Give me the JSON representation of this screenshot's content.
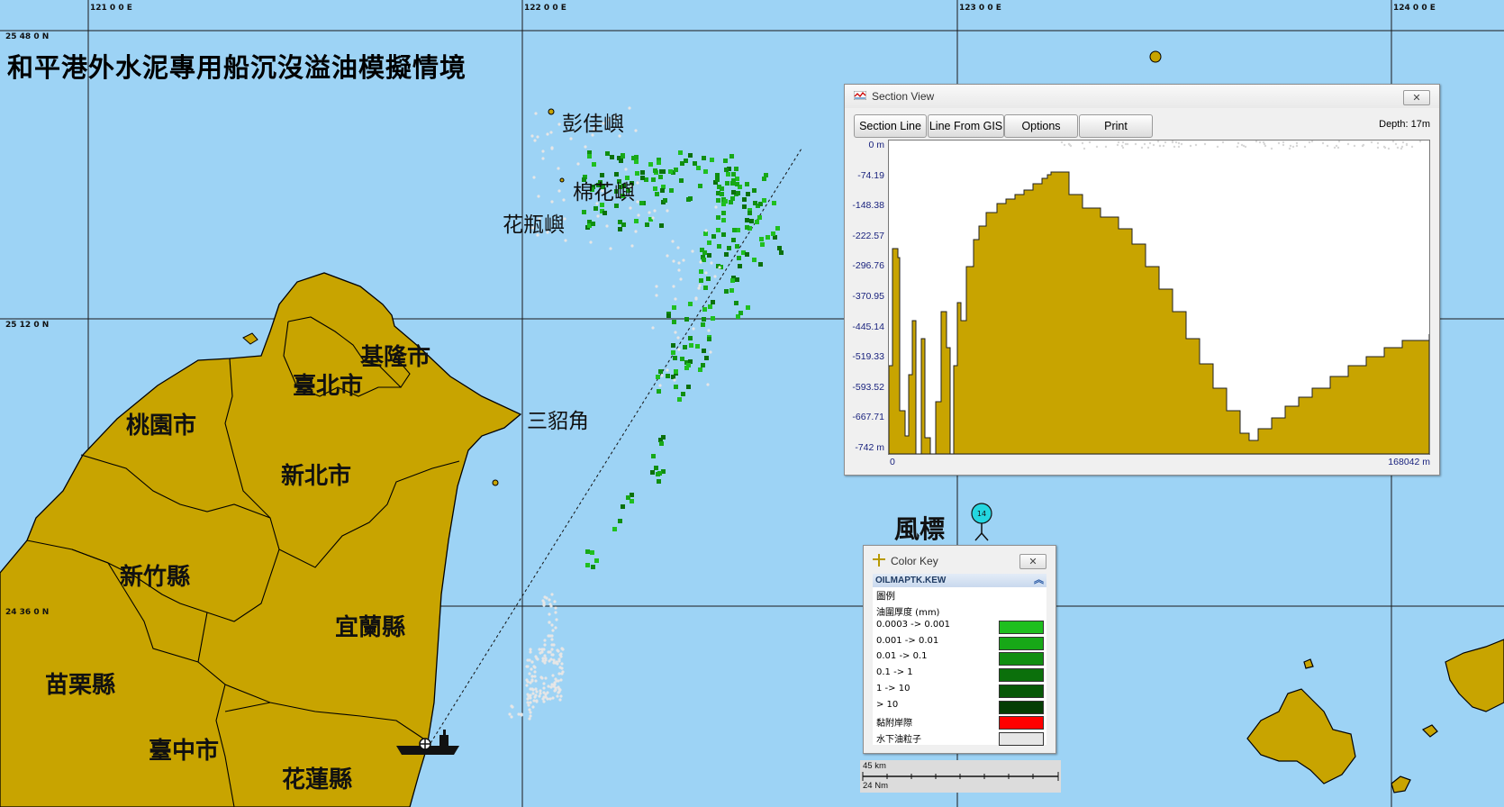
{
  "title": "和平港外水泥專用船沉沒溢油模擬情境",
  "grid": {
    "lon_labels": [
      "121 0 0 E",
      "122 0 0 E",
      "123 0 0 E",
      "124 0 0 E"
    ],
    "lat_labels": [
      "25 48 0 N",
      "25 12 0 N",
      "24 36 0 N"
    ]
  },
  "places": {
    "keelung": "基隆市",
    "taipei": "臺北市",
    "taoyuan": "桃園市",
    "newtaipei": "新北市",
    "hsinchu": "新竹縣",
    "yilan": "宜蘭縣",
    "miaoli": "苗栗縣",
    "taichung": "臺中市",
    "hualien": "花蓮縣",
    "sandiaojiao": "三貂角",
    "pengjia": "彭佳嶼",
    "mianhua": "棉花嶼",
    "huaping": "花瓶嶼"
  },
  "wind_buoy": {
    "label": "風標",
    "value": "14"
  },
  "section_view": {
    "title": "Section View",
    "buttons": [
      "Section Line",
      "Line From GIS",
      "Options",
      "Print"
    ],
    "depth_readout": "Depth: 17m",
    "y_ticks": [
      "0 m",
      "-74.19",
      "-148.38",
      "-222.57",
      "-296.76",
      "-370.95",
      "-445.14",
      "-519.33",
      "-593.52",
      "-667.71",
      "-742 m"
    ],
    "x_start": "0",
    "x_end": "168042 m",
    "colors": {
      "seabed": "#c8a400",
      "background": "#ffffff",
      "axis_text": "#1a237e"
    }
  },
  "color_key": {
    "title": "Color Key",
    "file": "OILMAPTK.KEW",
    "heading": "圖例",
    "subheading": "油圍厚度 (mm)",
    "items": [
      {
        "label": "0.0003 -> 0.001",
        "color": "#1fbf1f"
      },
      {
        "label": "0.001 -> 0.01",
        "color": "#17a817"
      },
      {
        "label": "0.01 -> 0.1",
        "color": "#108e10"
      },
      {
        "label": "0.1 -> 1",
        "color": "#0b700b"
      },
      {
        "label": "1 -> 10",
        "color": "#075807"
      },
      {
        "label": "> 10",
        "color": "#043d04"
      },
      {
        "label": "黏附岸際",
        "color": "#ff0000"
      },
      {
        "label": "水下油粒子",
        "color": "#e6e6e6"
      }
    ]
  },
  "scale_bar": {
    "km": "45 km",
    "nm": "24 Nm"
  },
  "map_colors": {
    "sea": "#9dd3f5",
    "land": "#c8a400",
    "oil": "#1fbf1f",
    "particles": "#e6e6e6"
  }
}
